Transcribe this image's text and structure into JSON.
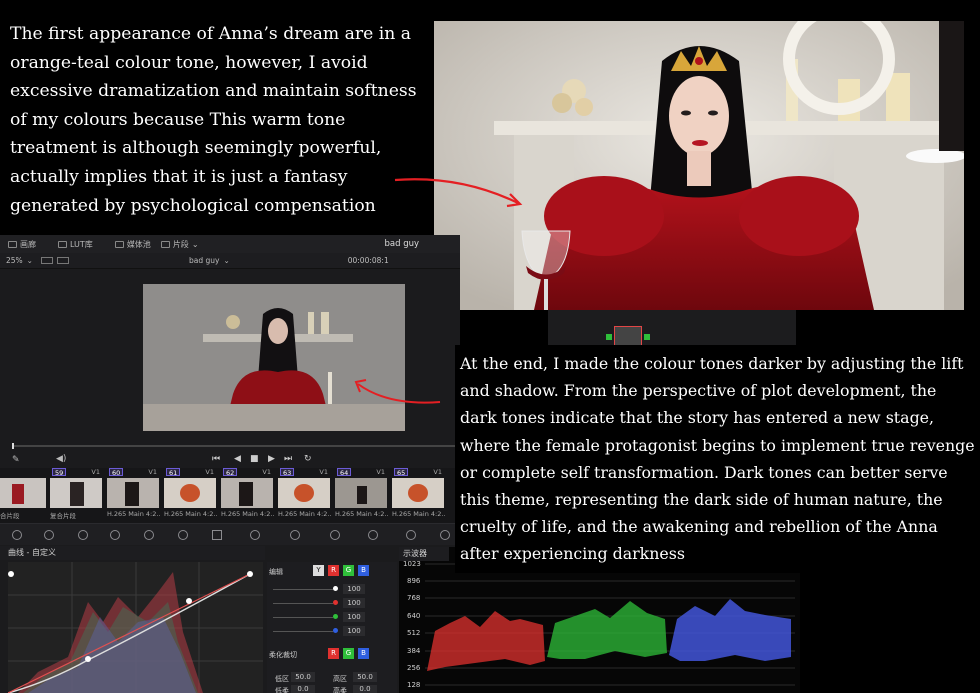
{
  "paragraph_top": "The first appearance of Anna’s dream are in a orange-teal colour tone, however, I avoid excessive dramatization and maintain softness of my colours because This warm tone treatment is although seemingly powerful, actually implies that it is just a fantasy generated by psychological compensation",
  "paragraph_bottom": "At the end, I made the colour tones darker by adjusting the lift and shadow. From the perspective of plot development, the dark tones indicate that the story has entered a new stage, where the female protagonist begins to implement true revenge or complete self transformation. Dark tones can better serve this theme, representing the dark side of human nature, the cruelty of life, and the awakening and rebellion of the Anna after experiencing darkness",
  "resolve": {
    "tabs": [
      "画廊",
      "LUT库",
      "媒体池",
      "片段"
    ],
    "project_title": "bad guy",
    "zoom": "25%",
    "timeline_name": "bad guy",
    "timecode": "00:00:08:1",
    "clips": [
      {
        "badge": "",
        "label": "合片段"
      },
      {
        "badge": "59",
        "label": "复合片段"
      },
      {
        "badge": "60",
        "label": "H.265 Main 4:2..."
      },
      {
        "badge": "61",
        "label": "H.265 Main 4:2..."
      },
      {
        "badge": "62",
        "label": "H.265 Main 4:2..."
      },
      {
        "badge": "63",
        "label": "H.265 Main 4:2..."
      },
      {
        "badge": "64",
        "label": "H.265 Main 4:2..."
      },
      {
        "badge": "65",
        "label": "H.265 Main 4:2..."
      }
    ],
    "track_label": "V1",
    "curves_title": "曲线 - 自定义",
    "edit_label": "编辑",
    "channel_values": [
      "100",
      "100",
      "100",
      "100"
    ],
    "soft_clip_label": "柔化裁切",
    "low_label": "低区",
    "low_value": "50.0",
    "high_label": "高区",
    "high_value": "50.0",
    "low_soft_label": "低柔",
    "low_soft_value": "0.0",
    "high_soft_label": "高柔",
    "high_soft_value": "0.0",
    "scope_title": "示波器",
    "scope_ticks": [
      "1023",
      "896",
      "768",
      "640",
      "512",
      "384",
      "256",
      "128"
    ],
    "rgb_labels": [
      "Y",
      "R",
      "G",
      "B"
    ],
    "rgb_colors": {
      "r": "#e0312f",
      "g": "#2fbf3a",
      "b": "#2f5fe0"
    }
  }
}
